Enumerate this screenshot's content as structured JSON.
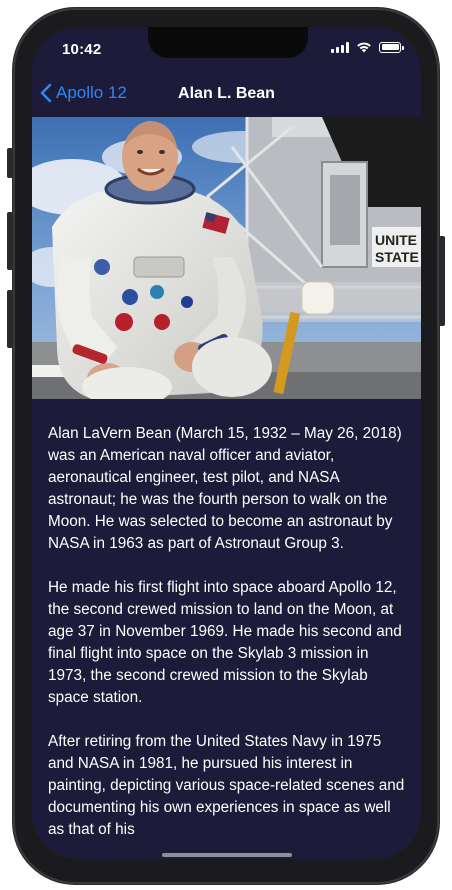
{
  "status_bar": {
    "time": "10:42",
    "icons": [
      "signal-icon",
      "wifi-icon",
      "battery-icon"
    ]
  },
  "nav": {
    "back_label": "Apollo 12",
    "back_icon": "chevron-left-icon",
    "title": "Alan L. Bean",
    "accent_color": "#2f86f6"
  },
  "hero": {
    "alt": "Alan L. Bean in spacesuit beside lunar module",
    "badge_text_line1": "UNITE",
    "badge_text_line2": "STATE"
  },
  "bio": {
    "paragraphs": [
      "Alan LaVern Bean (March 15, 1932 – May 26, 2018) was an American naval officer and aviator, aeronautical engineer, test pilot, and NASA astronaut; he was the fourth person to walk on the Moon. He was selected to become an astronaut by NASA in 1963 as part of Astronaut Group 3.",
      "He made his first flight into space aboard Apollo 12, the second crewed mission to land on the Moon, at age 37 in November 1969. He made his second and final flight into space on the Skylab 3 mission in 1973, the second crewed mission to the Skylab space station.",
      "After retiring from the United States Navy in 1975 and NASA in 1981, he pursued his interest in painting, depicting various space-related scenes and documenting his own experiences in space as well as that of his"
    ]
  },
  "colors": {
    "background": "#1c1c3a",
    "text": "#ffffff"
  }
}
